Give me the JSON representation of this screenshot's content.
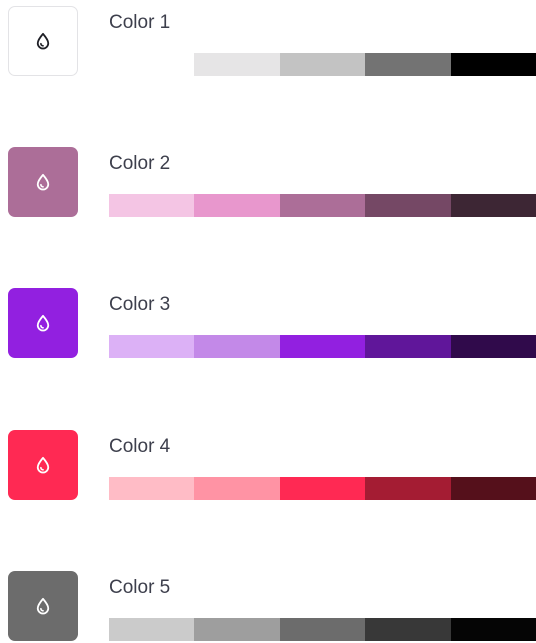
{
  "colors": [
    {
      "label": "Color 1",
      "base": "#ffffff",
      "icon_color": "#1e1f26",
      "icon": "drop-icon",
      "shades": [
        "#ffffff",
        "#e6e5e6",
        "#c3c3c3",
        "#737373",
        "#000000"
      ]
    },
    {
      "label": "Color 2",
      "base": "#ac6e98",
      "icon_color": "#ffffff",
      "icon": "drop-icon",
      "shades": [
        "#f4c5e4",
        "#e897cd",
        "#ac6e98",
        "#754865",
        "#3d2634"
      ]
    },
    {
      "label": "Color 3",
      "base": "#9220e0",
      "icon_color": "#ffffff",
      "icon": "drop-icon",
      "shades": [
        "#dcb1f6",
        "#c389e8",
        "#9220e0",
        "#60169a",
        "#300a4b"
      ]
    },
    {
      "label": "Color 4",
      "base": "#ff2953",
      "icon_color": "#ffffff",
      "icon": "drop-icon",
      "shades": [
        "#ffbcc6",
        "#ff93a4",
        "#ff2953",
        "#a41c33",
        "#55101b"
      ]
    },
    {
      "label": "Color 5",
      "base": "#6c6c6c",
      "icon_color": "#ffffff",
      "icon": "drop-icon",
      "shades": [
        "#cbcbcb",
        "#9e9e9e",
        "#6c6c6c",
        "#383838",
        "#050505"
      ]
    }
  ]
}
